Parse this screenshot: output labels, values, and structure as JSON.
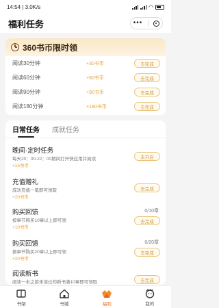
{
  "status": {
    "time": "14:54",
    "speed": "3.0K/s"
  },
  "header": {
    "title": "福利任务"
  },
  "limited": {
    "title": "360书币限时领",
    "rows": [
      {
        "label": "阅读30分钟",
        "reward": "+30书币",
        "button": "去完成"
      },
      {
        "label": "阅读60分钟",
        "reward": "+60书币",
        "button": "去完成"
      },
      {
        "label": "阅读90分钟",
        "reward": "+90书币",
        "button": "去完成"
      },
      {
        "label": "阅读180分钟",
        "reward": "+180书币",
        "button": "去完成"
      }
    ]
  },
  "tasks": {
    "tabs": [
      "日常任务",
      "成就任务"
    ],
    "items": [
      {
        "title": "晚间·定时任务",
        "desc": "每天20：00-22：00期间打开快应用并阅读",
        "reward": "+15书币",
        "button": "未开启"
      },
      {
        "title": "充值赠礼",
        "desc": "成功充值一笔即可领取",
        "reward": "+20书币",
        "button": "去完成"
      },
      {
        "title": "购买回馈",
        "desc": "按章节购买10章以上即可领",
        "reward": "+10书币",
        "progress": "0/10章",
        "button": "去完成"
      },
      {
        "title": "购买回馈",
        "desc": "按章节购买20章以上即可领",
        "reward": "+20书币",
        "progress": "0/20章",
        "button": "去完成"
      },
      {
        "title": "阅读新书",
        "desc": "阅读一本之前未读过的新书满10章即可领取",
        "button": "去完成"
      }
    ]
  },
  "tabbar": {
    "items": [
      {
        "label": "书架",
        "icon": "bookshelf-icon"
      },
      {
        "label": "书城",
        "icon": "home-icon"
      },
      {
        "label": "福利",
        "icon": "gift-icon"
      },
      {
        "label": "我的",
        "icon": "profile-icon"
      }
    ],
    "active_color": "#e86a1e"
  }
}
